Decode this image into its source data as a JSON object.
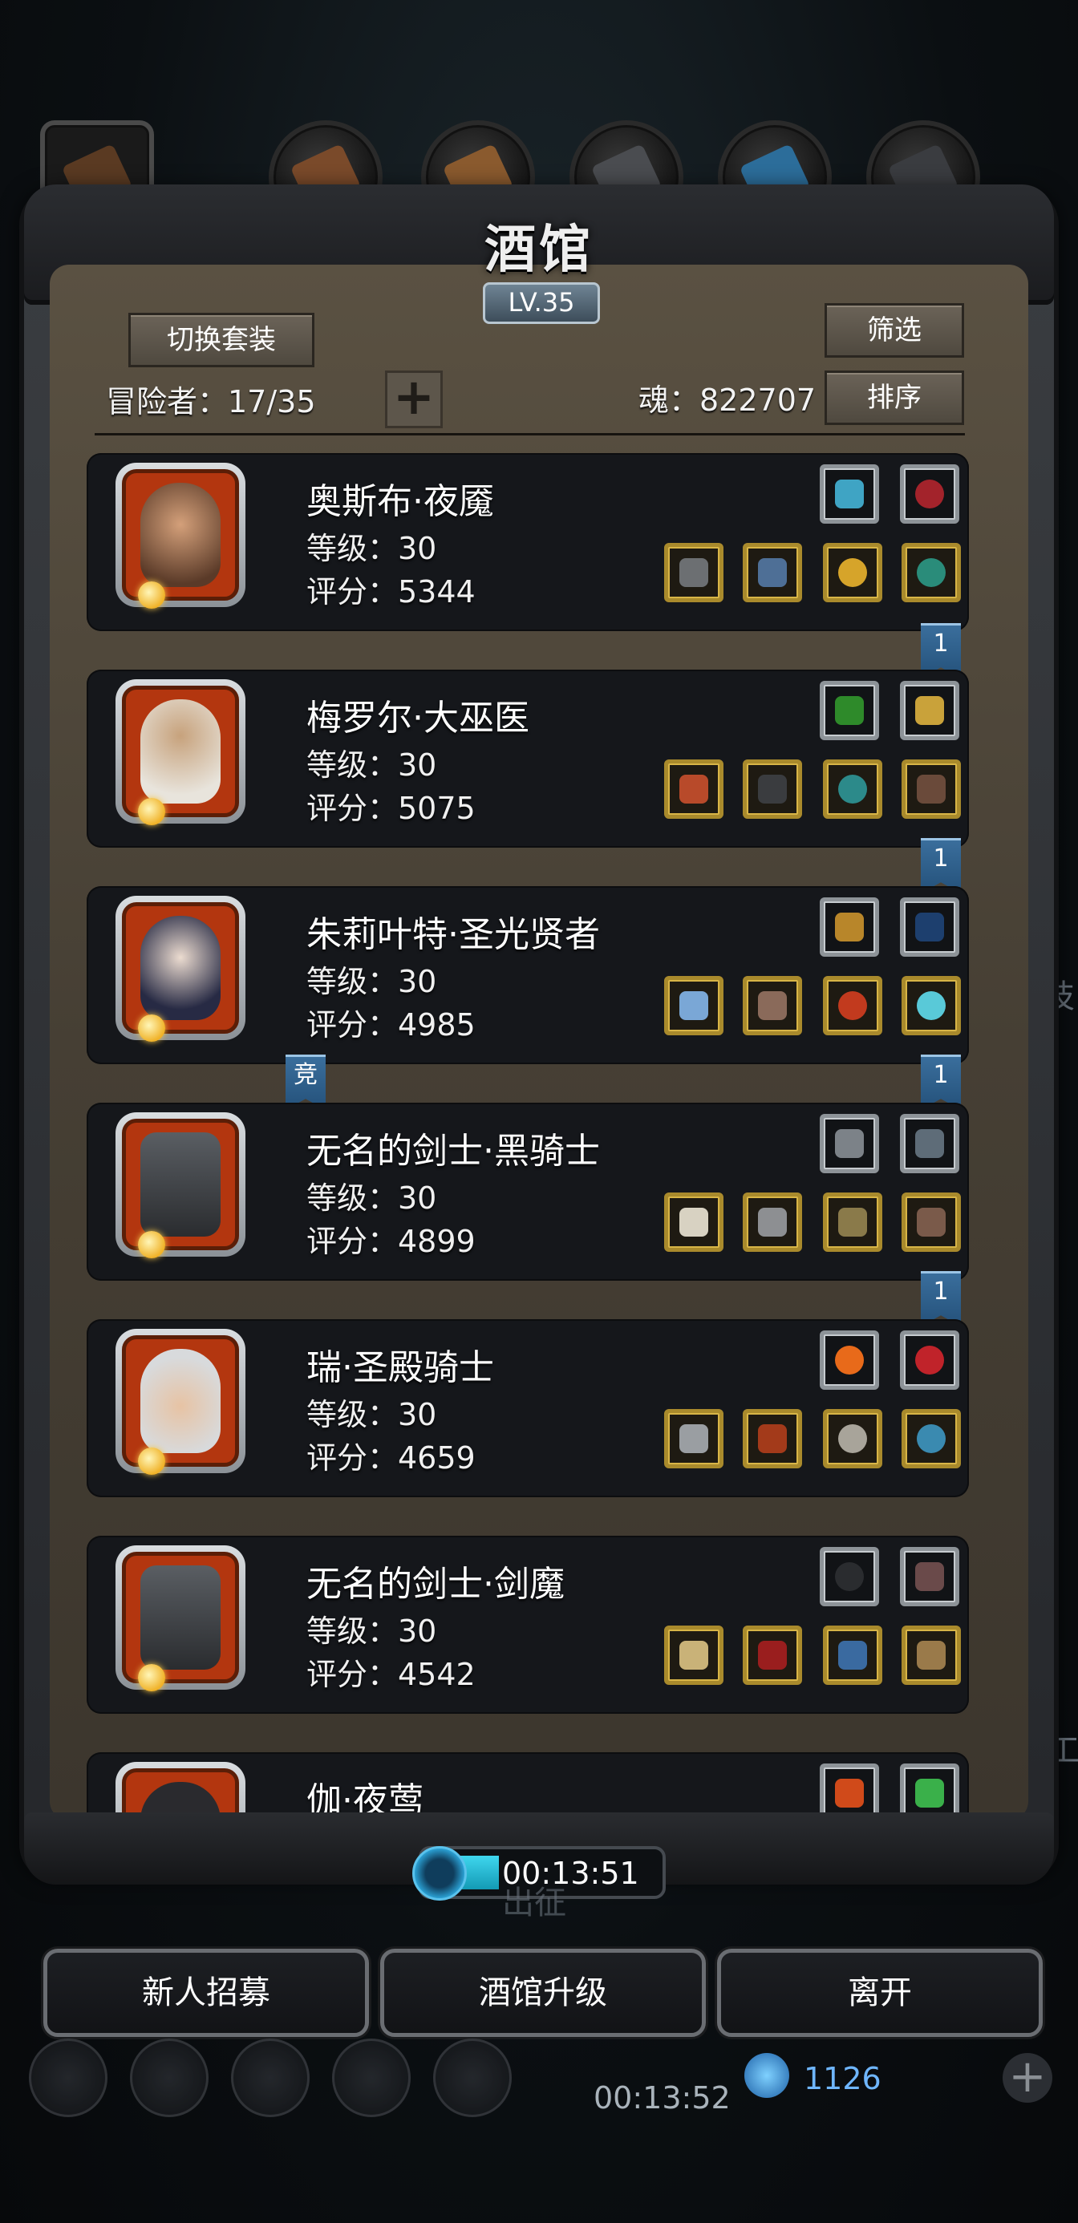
{
  "window": {
    "title": "酒馆",
    "level": "LV.35"
  },
  "header": {
    "switch_outfit_label": "切换套装",
    "filter_label": "筛选",
    "sort_label": "排序",
    "adventurers_label": "冒险者：17/35",
    "soul_label": "魂：822707",
    "add_icon": "plus-icon"
  },
  "heroes": [
    {
      "name": "奥斯布·夜魇",
      "level": "等级：30",
      "score": "评分：5344",
      "rank": "1"
    },
    {
      "name": "梅罗尔·大巫医",
      "level": "等级：30",
      "score": "评分：5075",
      "rank": "1"
    },
    {
      "name": "朱莉叶特·圣光贤者",
      "level": "等级：30",
      "score": "评分：4985",
      "rank": "1",
      "tag": "竞"
    },
    {
      "name": "无名的剑士·黑骑士",
      "level": "等级：30",
      "score": "评分：4899",
      "rank": "1"
    },
    {
      "name": "瑞·圣殿骑士",
      "level": "等级：30",
      "score": "评分：4659"
    },
    {
      "name": "无名的剑士·剑魔",
      "level": "等级：30",
      "score": "评分：4542"
    },
    {
      "name": "伽·夜莺"
    }
  ],
  "timer": {
    "value": "00:13:51",
    "progress": 0.2
  },
  "actions": {
    "recruit_label": "新人招募",
    "upgrade_label": "酒馆升级",
    "leave_label": "离开"
  },
  "background_hud": {
    "timer": "00:13:52",
    "gem_count": "1126",
    "expedition_label": "出征",
    "side_char_1": "技",
    "side_char_2": "工"
  },
  "colors": {
    "gold_slot": "#a98a2c",
    "silver_slot": "#8d9398",
    "rank_ribbon": "#2e5f8c",
    "timer_fill": "#2fc5e0"
  }
}
